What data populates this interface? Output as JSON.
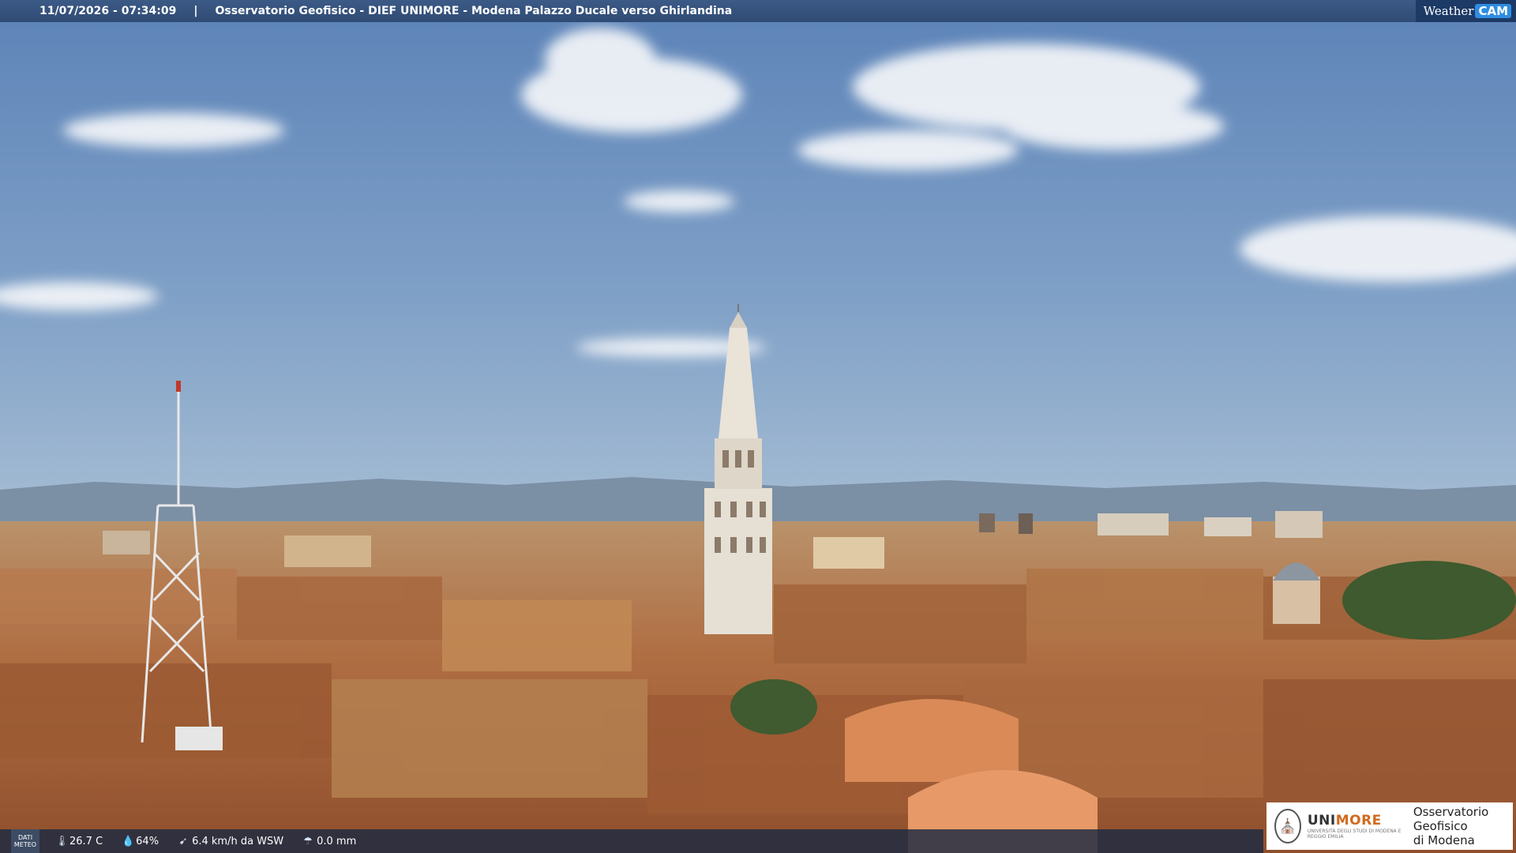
{
  "header": {
    "datetime": "11/07/2026 - 07:34:09",
    "separator": "|",
    "camera_title": "Osservatorio Geofisico - DIEF UNIMORE - Modena Palazzo Ducale verso Ghirlandina"
  },
  "brand": {
    "part1": "Weather",
    "part2": "CAM"
  },
  "weather": {
    "dati_label_line1": "DATI",
    "dati_label_line2": "METEO",
    "temperature": "26.7 C",
    "humidity": "64%",
    "wind": "6.4 km/h da WSW",
    "rain": "0.0 mm",
    "icons": [
      "thermometer-icon",
      "humidity-drop-icon",
      "wind-icon",
      "rain-icon"
    ]
  },
  "logo": {
    "uni": "UNI",
    "more": "MORE",
    "subtitle": "UNIVERSITÀ DEGLI STUDI DI MODENA E REGGIO EMILIA",
    "observatory_line1": "Osservatorio Geofisico",
    "observatory_line2": "di Modena"
  },
  "colors": {
    "sky_top": "#5c83b8",
    "sky_bottom": "#a6bdd4",
    "rooftops": "#a5673f",
    "tower": "#e6e0d4",
    "topbar": "#2f4b74",
    "brand_accent": "#2e8de0",
    "unimore_accent": "#d2691e"
  }
}
